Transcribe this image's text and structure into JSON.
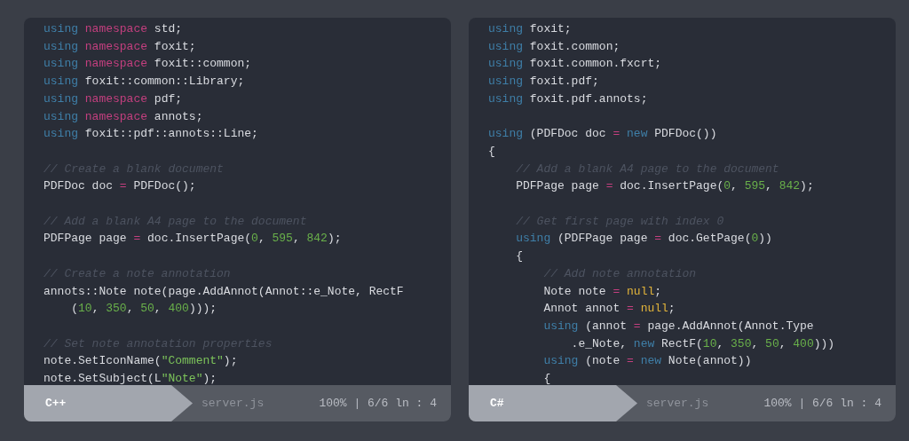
{
  "panels": [
    {
      "language": "C++",
      "file": "server.js",
      "status": "100% | 6/6 ln : 4",
      "lines": [
        {
          "tokens": [
            {
              "kind": "keyword",
              "text": "using",
              "gap": true
            },
            {
              "kind": "namespace",
              "text": "namespace",
              "gap": true
            },
            {
              "kind": "plain",
              "text": "std;"
            }
          ]
        },
        {
          "tokens": [
            {
              "kind": "keyword",
              "text": "using",
              "gap": true
            },
            {
              "kind": "namespace",
              "text": "namespace",
              "gap": true
            },
            {
              "kind": "plain",
              "text": "foxit;"
            }
          ]
        },
        {
          "tokens": [
            {
              "kind": "keyword",
              "text": "using",
              "gap": true
            },
            {
              "kind": "namespace",
              "text": "namespace",
              "gap": true
            },
            {
              "kind": "plain",
              "text": "foxit::common;"
            }
          ]
        },
        {
          "tokens": [
            {
              "kind": "keyword",
              "text": "using",
              "gap": true
            },
            {
              "kind": "plain",
              "text": "foxit::common::Library;"
            }
          ]
        },
        {
          "tokens": [
            {
              "kind": "keyword",
              "text": "using",
              "gap": true
            },
            {
              "kind": "namespace",
              "text": "namespace",
              "gap": true
            },
            {
              "kind": "plain",
              "text": "pdf;"
            }
          ]
        },
        {
          "tokens": [
            {
              "kind": "keyword",
              "text": "using",
              "gap": true
            },
            {
              "kind": "namespace",
              "text": "namespace",
              "gap": true
            },
            {
              "kind": "plain",
              "text": "annots;"
            }
          ]
        },
        {
          "tokens": [
            {
              "kind": "keyword",
              "text": "using",
              "gap": true
            },
            {
              "kind": "plain",
              "text": "foxit::pdf::annots::Line;"
            }
          ]
        },
        {
          "space_before": true,
          "tokens": [
            {
              "kind": "comment",
              "text": "// Create a blank document"
            }
          ]
        },
        {
          "tokens": [
            {
              "kind": "plain",
              "text": "PDFDoc doc",
              "gap": true
            },
            {
              "kind": "operator",
              "text": "=",
              "gap": true
            },
            {
              "kind": "plain",
              "text": "PDFDoc();"
            }
          ]
        },
        {
          "space_before": true,
          "tokens": [
            {
              "kind": "comment",
              "text": "// Add a blank A4 page to the document"
            }
          ]
        },
        {
          "tokens": [
            {
              "kind": "plain",
              "text": "PDFPage page",
              "gap": true
            },
            {
              "kind": "operator",
              "text": "=",
              "gap": true
            },
            {
              "kind": "plain",
              "text": "doc.InsertPage("
            },
            {
              "kind": "number",
              "text": "0"
            },
            {
              "kind": "plain",
              "text": ",",
              "gap": true
            },
            {
              "kind": "number",
              "text": "595"
            },
            {
              "kind": "plain",
              "text": ",",
              "gap": true
            },
            {
              "kind": "number",
              "text": "842"
            },
            {
              "kind": "plain",
              "text": ");"
            }
          ]
        },
        {
          "space_before": true,
          "tokens": [
            {
              "kind": "comment",
              "text": "// Create a note annotation"
            }
          ]
        },
        {
          "tokens": [
            {
              "kind": "plain",
              "text": "annots::Note note(page.AddAnnot(Annot::e_Note, RectF"
            }
          ],
          "children": [
            {
              "tokens": [
                {
                  "kind": "plain",
                  "text": "("
                },
                {
                  "kind": "number",
                  "text": "10"
                },
                {
                  "kind": "plain",
                  "text": ",",
                  "gap": true
                },
                {
                  "kind": "number",
                  "text": "350"
                },
                {
                  "kind": "plain",
                  "text": ",",
                  "gap": true
                },
                {
                  "kind": "number",
                  "text": "50"
                },
                {
                  "kind": "plain",
                  "text": ",",
                  "gap": true
                },
                {
                  "kind": "number",
                  "text": "400"
                },
                {
                  "kind": "plain",
                  "text": ")));"
                }
              ]
            }
          ]
        },
        {
          "space_before": true,
          "tokens": [
            {
              "kind": "comment",
              "text": "// Set note annotation properties"
            }
          ]
        },
        {
          "tokens": [
            {
              "kind": "plain",
              "text": "note.SetIconName("
            },
            {
              "kind": "string",
              "text": "\"Comment\""
            },
            {
              "kind": "plain",
              "text": ");"
            }
          ]
        },
        {
          "tokens": [
            {
              "kind": "plain",
              "text": "note.SetSubject(L"
            },
            {
              "kind": "string",
              "text": "\"Note\""
            },
            {
              "kind": "plain",
              "text": ");"
            }
          ]
        }
      ]
    },
    {
      "language": "C#",
      "file": "server.js",
      "status": "100% | 6/6 ln : 4",
      "lines": [
        {
          "tokens": [
            {
              "kind": "keyword",
              "text": "using",
              "gap": true
            },
            {
              "kind": "plain",
              "text": "foxit;"
            }
          ]
        },
        {
          "tokens": [
            {
              "kind": "keyword",
              "text": "using",
              "gap": true
            },
            {
              "kind": "plain",
              "text": "foxit.common;"
            }
          ]
        },
        {
          "tokens": [
            {
              "kind": "keyword",
              "text": "using",
              "gap": true
            },
            {
              "kind": "plain",
              "text": "foxit.common.fxcrt;"
            }
          ]
        },
        {
          "tokens": [
            {
              "kind": "keyword",
              "text": "using",
              "gap": true
            },
            {
              "kind": "plain",
              "text": "foxit.pdf;"
            }
          ]
        },
        {
          "tokens": [
            {
              "kind": "keyword",
              "text": "using",
              "gap": true
            },
            {
              "kind": "plain",
              "text": "foxit.pdf.annots;"
            }
          ]
        },
        {
          "space_before": true,
          "tokens": [
            {
              "kind": "keyword",
              "text": "using",
              "gap": true
            },
            {
              "kind": "plain",
              "text": "(PDFDoc doc",
              "gap": true
            },
            {
              "kind": "operator",
              "text": "=",
              "gap": true
            },
            {
              "kind": "keyword",
              "text": "new",
              "gap": true
            },
            {
              "kind": "plain",
              "text": "PDFDoc())"
            }
          ]
        },
        {
          "tokens": [
            {
              "kind": "plain",
              "text": "{"
            }
          ],
          "children": [
            {
              "tokens": [
                {
                  "kind": "comment",
                  "text": "// Add a blank A4 page to the document"
                }
              ]
            },
            {
              "tokens": [
                {
                  "kind": "plain",
                  "text": "PDFPage page",
                  "gap": true
                },
                {
                  "kind": "operator",
                  "text": "=",
                  "gap": true
                },
                {
                  "kind": "plain",
                  "text": "doc.InsertPage("
                },
                {
                  "kind": "number",
                  "text": "0"
                },
                {
                  "kind": "plain",
                  "text": ",",
                  "gap": true
                },
                {
                  "kind": "number",
                  "text": "595"
                },
                {
                  "kind": "plain",
                  "text": ",",
                  "gap": true
                },
                {
                  "kind": "number",
                  "text": "842"
                },
                {
                  "kind": "plain",
                  "text": ");"
                }
              ]
            },
            {
              "space_before": true,
              "tokens": [
                {
                  "kind": "comment",
                  "text": "// Get first page with index 0"
                }
              ]
            },
            {
              "tokens": [
                {
                  "kind": "keyword",
                  "text": "using",
                  "gap": true
                },
                {
                  "kind": "plain",
                  "text": "(PDFPage page",
                  "gap": true
                },
                {
                  "kind": "operator",
                  "text": "=",
                  "gap": true
                },
                {
                  "kind": "plain",
                  "text": "doc.GetPage("
                },
                {
                  "kind": "number",
                  "text": "0"
                },
                {
                  "kind": "plain",
                  "text": "))"
                }
              ]
            },
            {
              "tokens": [
                {
                  "kind": "plain",
                  "text": "{"
                }
              ],
              "children": [
                {
                  "tokens": [
                    {
                      "kind": "comment",
                      "text": "// Add note annotation"
                    }
                  ]
                },
                {
                  "tokens": [
                    {
                      "kind": "plain",
                      "text": "Note note",
                      "gap": true
                    },
                    {
                      "kind": "operator",
                      "text": "=",
                      "gap": true
                    },
                    {
                      "kind": "null",
                      "text": "null"
                    },
                    {
                      "kind": "plain",
                      "text": ";"
                    }
                  ]
                },
                {
                  "tokens": [
                    {
                      "kind": "plain",
                      "text": "Annot annot",
                      "gap": true
                    },
                    {
                      "kind": "operator",
                      "text": "=",
                      "gap": true
                    },
                    {
                      "kind": "null",
                      "text": "null"
                    },
                    {
                      "kind": "plain",
                      "text": ";"
                    }
                  ]
                },
                {
                  "tokens": [
                    {
                      "kind": "keyword",
                      "text": "using",
                      "gap": true
                    },
                    {
                      "kind": "plain",
                      "text": "(annot",
                      "gap": true
                    },
                    {
                      "kind": "operator",
                      "text": "=",
                      "gap": true
                    },
                    {
                      "kind": "plain",
                      "text": "page.AddAnnot(Annot.Type"
                    }
                  ],
                  "children": [
                    {
                      "tokens": [
                        {
                          "kind": "plain",
                          "text": ".e_Note,",
                          "gap": true
                        },
                        {
                          "kind": "keyword",
                          "text": "new",
                          "gap": true
                        },
                        {
                          "kind": "plain",
                          "text": "RectF("
                        },
                        {
                          "kind": "number",
                          "text": "10"
                        },
                        {
                          "kind": "plain",
                          "text": ",",
                          "gap": true
                        },
                        {
                          "kind": "number",
                          "text": "350"
                        },
                        {
                          "kind": "plain",
                          "text": ",",
                          "gap": true
                        },
                        {
                          "kind": "number",
                          "text": "50"
                        },
                        {
                          "kind": "plain",
                          "text": ",",
                          "gap": true
                        },
                        {
                          "kind": "number",
                          "text": "400"
                        },
                        {
                          "kind": "plain",
                          "text": ")))"
                        }
                      ]
                    }
                  ]
                },
                {
                  "tokens": [
                    {
                      "kind": "keyword",
                      "text": "using",
                      "gap": true
                    },
                    {
                      "kind": "plain",
                      "text": "(note",
                      "gap": true
                    },
                    {
                      "kind": "operator",
                      "text": "=",
                      "gap": true
                    },
                    {
                      "kind": "keyword",
                      "text": "new",
                      "gap": true
                    },
                    {
                      "kind": "plain",
                      "text": "Note(annot))"
                    }
                  ]
                },
                {
                  "tokens": [
                    {
                      "kind": "plain",
                      "text": "{"
                    }
                  ]
                }
              ]
            }
          ]
        }
      ]
    }
  ]
}
